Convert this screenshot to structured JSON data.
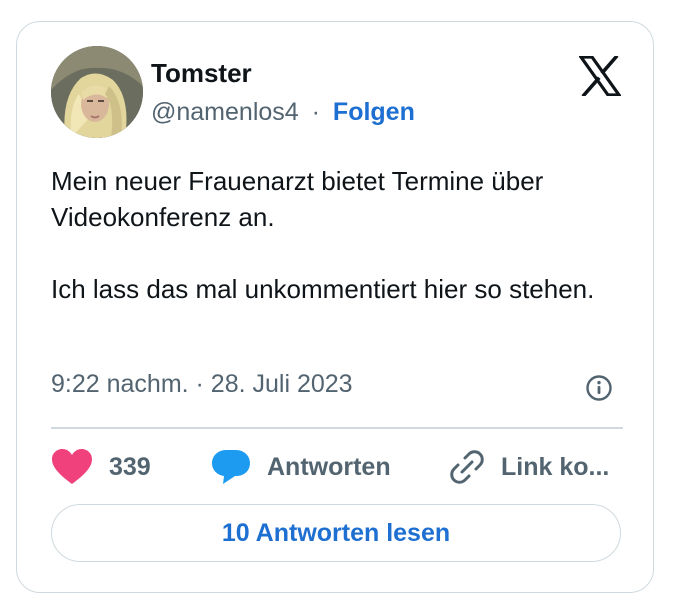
{
  "author": {
    "name": "Tomster",
    "handle": "@namenlos4",
    "separator": "·",
    "follow_label": "Folgen"
  },
  "tweet": {
    "paragraphs": [
      "Mein neuer Frauenarzt bietet Termine über Videokonferenz an.",
      "Ich lass das mal unkommentiert hier so stehen."
    ],
    "timestamp": "9:22 nachm. · 28. Juli 2023"
  },
  "actions": {
    "like_count": "339",
    "reply_label": "Antworten",
    "copy_link_label": "Link ko..."
  },
  "read_replies_label": "10 Antworten lesen",
  "icons": {
    "logo": "x-logo-icon",
    "info": "info-icon",
    "like": "heart-icon",
    "reply": "speech-bubble-icon",
    "link": "link-icon"
  },
  "colors": {
    "accent": "#1d6fd1",
    "like": "#f0417d",
    "reply": "#1d9bf0",
    "secondary_text": "#536471",
    "border": "#cfd9de"
  }
}
